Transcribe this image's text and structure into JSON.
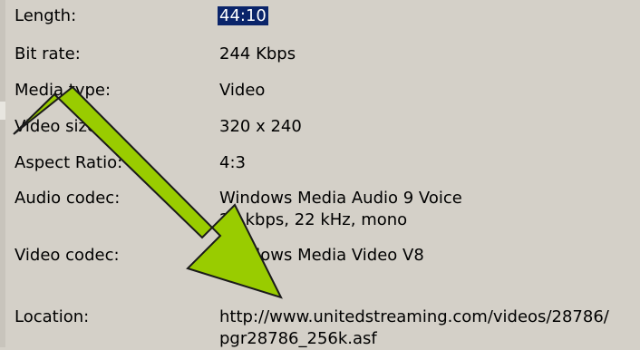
{
  "properties": [
    {
      "label": "Length:",
      "value": "44:10"
    },
    {
      "label": "Bit rate:",
      "value": "244 Kbps"
    },
    {
      "label": "Media type:",
      "value": "Video"
    },
    {
      "label": "Video size:",
      "value": "320 x 240"
    },
    {
      "label": "Aspect Ratio:",
      "value": "4:3"
    },
    {
      "label": "Audio codec:",
      "value": "Windows Media Audio 9 Voice",
      "value2": "20 kbps, 22 kHz, mono"
    },
    {
      "label": "Video codec:",
      "value": "Windows Media Video V8"
    },
    {
      "label": "Location:",
      "value": "http://www.unitedstreaming.com/videos/28786/",
      "value2": "pgr28786_256k.asf"
    }
  ],
  "colors": {
    "background": "#d4d0c8",
    "selection": "#0a246a",
    "arrow_fill": "#99cc00",
    "arrow_stroke": "#1a1a1a"
  },
  "icons": {
    "arrow": "green-diagonal-arrow-icon"
  }
}
